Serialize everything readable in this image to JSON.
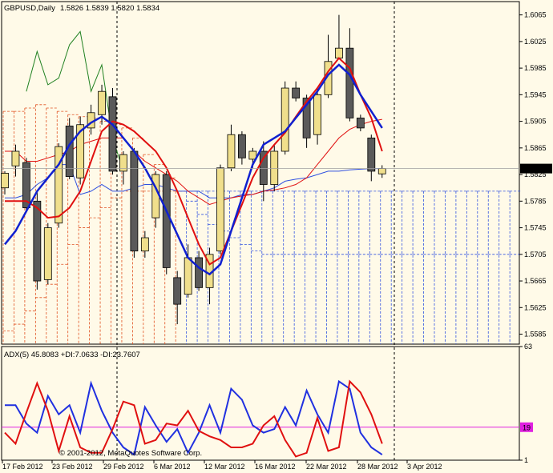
{
  "colors": {
    "background": "#fffae8",
    "frame": "#000000",
    "bull_candle": "#f0df8c",
    "bear_candle": "#5a5a5a",
    "cloud_red": "#e05020",
    "cloud_blue": "#3050e0",
    "ma_red": "#e01010",
    "ma_blue": "#1020d0",
    "tenkan_green": "#208020",
    "adx_level": "#e020e0",
    "last_price_line": "#a0a0a0"
  },
  "header": {
    "symbol": "GBPUSD,Daily",
    "ohlc": "1.5826 1.5839 1.5820 1.5834"
  },
  "copyright": "© 2001-2012, MetaQuotes Software Corp.",
  "chart_data": [
    {
      "type": "candlestick",
      "symbol": "GBPUSD",
      "timeframe": "Daily",
      "y_ticks": [
        "1.6065",
        "1.6025",
        "1.5985",
        "1.5945",
        "1.5905",
        "1.5865",
        "1.5825",
        "1.5785",
        "1.5745",
        "1.5705",
        "1.5665",
        "1.5625",
        "1.5585"
      ],
      "ylim": [
        1.557,
        1.6085
      ],
      "last_price": "1.5834",
      "candles": [
        {
          "o": 1.5805,
          "h": 1.583,
          "l": 1.5795,
          "c": 1.5827
        },
        {
          "o": 1.5838,
          "h": 1.587,
          "l": 1.5822,
          "c": 1.586
        },
        {
          "o": 1.5843,
          "h": 1.585,
          "l": 1.577,
          "c": 1.5775
        },
        {
          "o": 1.5785,
          "h": 1.5798,
          "l": 1.5652,
          "c": 1.5665
        },
        {
          "o": 1.5667,
          "h": 1.5752,
          "l": 1.566,
          "c": 1.5745
        },
        {
          "o": 1.5752,
          "h": 1.5872,
          "l": 1.5745,
          "c": 1.5867
        },
        {
          "o": 1.5898,
          "h": 1.591,
          "l": 1.5818,
          "c": 1.5822
        },
        {
          "o": 1.582,
          "h": 1.5912,
          "l": 1.581,
          "c": 1.59
        },
        {
          "o": 1.5895,
          "h": 1.593,
          "l": 1.5885,
          "c": 1.5918
        },
        {
          "o": 1.5915,
          "h": 1.596,
          "l": 1.59,
          "c": 1.595
        },
        {
          "o": 1.5942,
          "h": 1.5955,
          "l": 1.5825,
          "c": 1.583
        },
        {
          "o": 1.583,
          "h": 1.586,
          "l": 1.581,
          "c": 1.5855
        },
        {
          "o": 1.586,
          "h": 1.5865,
          "l": 1.57,
          "c": 1.571
        },
        {
          "o": 1.571,
          "h": 1.574,
          "l": 1.57,
          "c": 1.573
        },
        {
          "o": 1.576,
          "h": 1.583,
          "l": 1.5745,
          "c": 1.5825
        },
        {
          "o": 1.5825,
          "h": 1.583,
          "l": 1.5675,
          "c": 1.5685
        },
        {
          "o": 1.567,
          "h": 1.568,
          "l": 1.56,
          "c": 1.563
        },
        {
          "o": 1.5645,
          "h": 1.572,
          "l": 1.564,
          "c": 1.57
        },
        {
          "o": 1.57,
          "h": 1.571,
          "l": 1.565,
          "c": 1.5655
        },
        {
          "o": 1.5655,
          "h": 1.5715,
          "l": 1.563,
          "c": 1.5705
        },
        {
          "o": 1.571,
          "h": 1.584,
          "l": 1.5705,
          "c": 1.5835
        },
        {
          "o": 1.5835,
          "h": 1.59,
          "l": 1.583,
          "c": 1.5885
        },
        {
          "o": 1.5885,
          "h": 1.589,
          "l": 1.584,
          "c": 1.585
        },
        {
          "o": 1.5848,
          "h": 1.5865,
          "l": 1.5835,
          "c": 1.586
        },
        {
          "o": 1.586,
          "h": 1.5875,
          "l": 1.5785,
          "c": 1.581
        },
        {
          "o": 1.581,
          "h": 1.587,
          "l": 1.58,
          "c": 1.586
        },
        {
          "o": 1.586,
          "h": 1.5965,
          "l": 1.5855,
          "c": 1.5955
        },
        {
          "o": 1.5955,
          "h": 1.5965,
          "l": 1.5935,
          "c": 1.594
        },
        {
          "o": 1.594,
          "h": 1.5945,
          "l": 1.5865,
          "c": 1.588
        },
        {
          "o": 1.5885,
          "h": 1.5955,
          "l": 1.587,
          "c": 1.5945
        },
        {
          "o": 1.5945,
          "h": 1.6035,
          "l": 1.594,
          "c": 1.5995
        },
        {
          "o": 1.6,
          "h": 1.6065,
          "l": 1.6,
          "c": 1.6015
        },
        {
          "o": 1.6015,
          "h": 1.6045,
          "l": 1.5905,
          "c": 1.591
        },
        {
          "o": 1.591,
          "h": 1.5915,
          "l": 1.589,
          "c": 1.5895
        },
        {
          "o": 1.588,
          "h": 1.5885,
          "l": 1.5815,
          "c": 1.583
        },
        {
          "o": 1.5826,
          "h": 1.5839,
          "l": 1.582,
          "c": 1.5834
        }
      ],
      "ma_red": [
        1.5785,
        1.5785,
        1.5785,
        1.5775,
        1.576,
        1.5762,
        1.5775,
        1.58,
        1.5845,
        1.589,
        1.5905,
        1.59,
        1.589,
        1.5875,
        1.586,
        1.5835,
        1.58,
        1.576,
        1.572,
        1.569,
        1.57,
        1.574,
        1.578,
        1.582,
        1.585,
        1.587,
        1.5888,
        1.5912,
        1.5935,
        1.5955,
        1.598,
        1.6,
        1.5985,
        1.5945,
        1.591,
        1.586
      ],
      "ma_blue": [
        1.572,
        1.574,
        1.577,
        1.58,
        1.582,
        1.584,
        1.587,
        1.589,
        1.5903,
        1.5912,
        1.59,
        1.588,
        1.586,
        1.5835,
        1.5805,
        1.577,
        1.5735,
        1.57,
        1.5685,
        1.5675,
        1.569,
        1.574,
        1.579,
        1.584,
        1.587,
        1.588,
        1.589,
        1.591,
        1.593,
        1.595,
        1.5975,
        1.599,
        1.5975,
        1.5945,
        1.592,
        1.5895
      ],
      "ichimoku_tenkan": [
        1.586,
        1.586,
        1.5845,
        1.5845,
        1.585,
        1.5855,
        1.586,
        1.587,
        1.5875,
        1.588,
        1.588,
        1.588,
        1.586,
        1.5845,
        1.5835,
        1.5825,
        1.5815,
        1.58,
        1.579,
        1.578,
        1.5785,
        1.579,
        1.5793,
        1.5795,
        1.58,
        1.5802,
        1.5805,
        1.581,
        1.582,
        1.584,
        1.586,
        1.588,
        1.5893,
        1.59,
        1.5905,
        1.5908
      ],
      "ichimoku_chikou": [
        1.579,
        1.579,
        1.5795,
        1.581,
        1.582,
        1.584,
        1.584,
        1.5795,
        1.58,
        1.581,
        1.58,
        1.58,
        1.5805,
        1.581,
        1.581,
        1.5805,
        1.58,
        1.58,
        1.58,
        1.579,
        1.579,
        1.579,
        1.5795,
        1.5795,
        1.58,
        1.5805,
        1.5815,
        1.5818,
        1.582,
        1.5825,
        1.583,
        1.583,
        1.5832,
        1.5833,
        1.5834,
        1.5834
      ],
      "ichimoku_green": [
        null,
        null,
        1.595,
        1.601,
        1.596,
        1.597,
        1.602,
        1.604,
        1.595,
        1.599,
        1.588,
        1.583,
        null,
        null,
        null,
        null,
        null,
        null,
        null,
        null,
        null,
        null,
        null,
        null,
        null,
        null,
        null,
        null,
        null,
        null,
        null,
        null,
        null,
        null,
        null,
        null
      ],
      "cloud_span_a": [
        1.592,
        1.592,
        1.5925,
        1.593,
        1.5925,
        1.592,
        1.5915,
        1.5912,
        1.591,
        1.5905,
        1.59,
        1.5895,
        1.588,
        1.5855,
        1.584,
        1.582,
        1.58,
        1.5785,
        1.5765,
        1.575,
        1.574,
        1.573,
        1.572,
        1.571,
        1.5705,
        1.5705,
        1.5705,
        1.5705,
        1.5705,
        1.5705,
        1.5705,
        1.5705,
        1.5705,
        1.5705,
        1.5705,
        1.5705,
        1.5705,
        1.5705,
        1.5705,
        1.5705,
        1.5705,
        1.5705,
        1.5705,
        1.5705,
        1.5705,
        1.5705,
        1.5705,
        1.5705,
        1.5705,
        1.5705,
        1.5705,
        1.5705,
        1.5705,
        1.5705,
        1.5705,
        1.5705,
        1.5705,
        1.5705,
        1.5705,
        1.5705,
        1.5705
      ],
      "cloud_span_b": [
        1.559,
        1.56,
        1.562,
        1.564,
        1.566,
        1.569,
        1.572,
        1.5745,
        1.576,
        1.5775,
        1.579,
        1.58,
        1.58,
        1.58,
        1.58,
        1.58,
        1.58,
        1.58,
        1.58,
        1.58,
        1.58,
        1.58,
        1.58,
        1.58,
        1.58,
        1.58,
        1.58,
        1.58,
        1.58,
        1.58,
        1.58,
        1.58,
        1.58,
        1.58,
        1.58,
        1.58,
        1.58,
        1.58,
        1.58,
        1.58,
        1.58,
        1.58,
        1.58,
        1.58,
        1.58,
        1.58,
        1.58,
        1.58,
        1.58,
        1.58,
        1.58,
        1.58,
        1.58,
        1.58,
        1.58,
        1.58,
        1.58,
        1.58,
        1.58,
        1.58,
        1.58
      ]
    },
    {
      "type": "line",
      "title": "ADX(5) 45.8083 +DI:7.0633 -DI:23.7607",
      "ylim": [
        1,
        63
      ],
      "y_ticks": [
        "63",
        "19",
        "1"
      ],
      "level": 19,
      "series": [
        {
          "color": "#2030e0",
          "values": [
            31,
            31,
            21,
            16,
            36,
            26,
            31,
            16,
            43,
            28,
            16,
            8,
            4,
            30,
            20,
            11,
            18,
            5,
            16,
            31,
            16,
            40,
            34,
            20,
            16,
            18,
            30,
            20,
            39,
            26,
            16,
            44,
            40,
            16,
            8,
            4
          ]
        },
        {
          "color": "#e01010",
          "values": [
            16,
            10,
            27,
            43,
            28,
            6,
            25,
            8,
            5,
            5,
            18,
            33,
            31,
            10,
            12,
            21,
            20,
            28,
            17,
            14,
            12,
            8,
            8,
            10,
            20,
            25,
            12,
            3,
            5,
            24,
            6,
            8,
            44,
            38,
            26,
            10
          ]
        }
      ]
    }
  ],
  "x_axis": {
    "labels": [
      "17 Feb 2012",
      "23 Feb 2012",
      "29 Feb 2012",
      "6 Mar 2012",
      "12 Mar 2012",
      "16 Mar 2012",
      "22 Mar 2012",
      "28 Mar 2012",
      "3 Apr 2012"
    ]
  }
}
